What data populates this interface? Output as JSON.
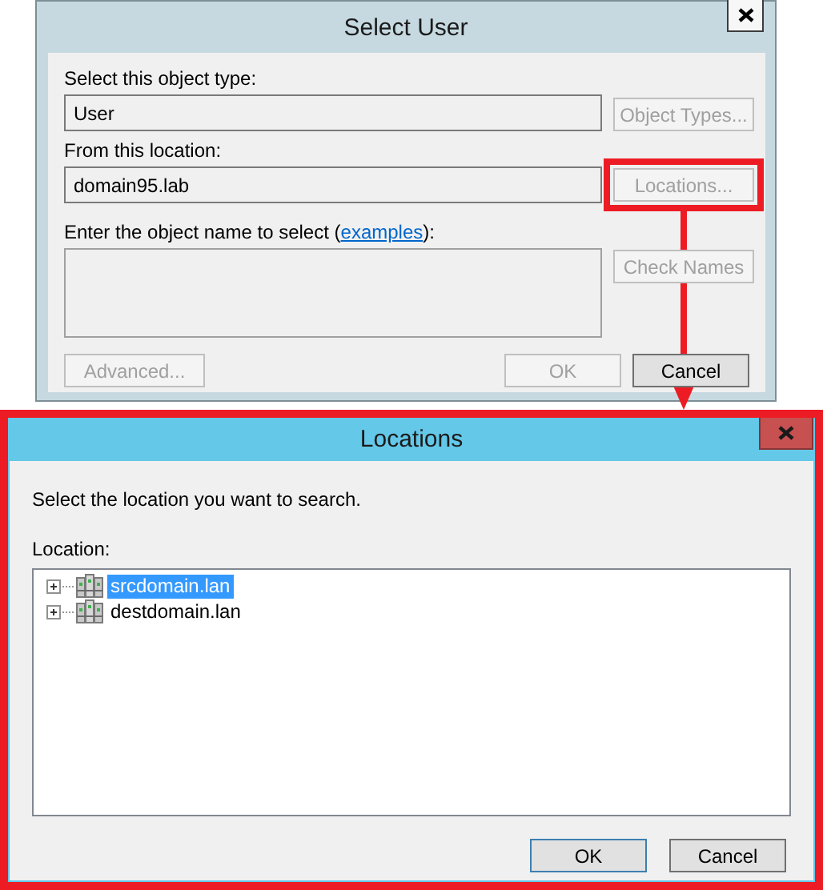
{
  "select_user_dialog": {
    "title": "Select User",
    "object_type": {
      "label": "Select this object type:",
      "value": "User",
      "button": {
        "label": "Object Types...",
        "disabled": true,
        "highlighted": false
      }
    },
    "location": {
      "label": "From this location:",
      "value": "domain95.lab",
      "button": {
        "label": "Locations...",
        "disabled": true,
        "highlighted": true
      }
    },
    "object_names": {
      "label_before": "Enter the object name to select (",
      "link": "examples",
      "label_after": "):",
      "button": {
        "label": "Check Names",
        "disabled": true,
        "highlighted": false
      }
    },
    "buttons": [
      {
        "label": "Advanced...",
        "disabled": true
      },
      {
        "label": "OK",
        "disabled": true
      },
      {
        "label": "Cancel",
        "disabled": false
      }
    ]
  },
  "locations_dialog": {
    "title": "Locations",
    "prompt": "Select the location you want to search.",
    "list_label": "Location:",
    "items": [
      {
        "label": "srcdomain.lan",
        "selected": true,
        "expanded": false
      },
      {
        "label": "destdomain.lan",
        "selected": false,
        "expanded": false
      }
    ],
    "buttons": [
      {
        "label": "OK",
        "default": true
      },
      {
        "label": "Cancel",
        "default": false
      }
    ]
  }
}
